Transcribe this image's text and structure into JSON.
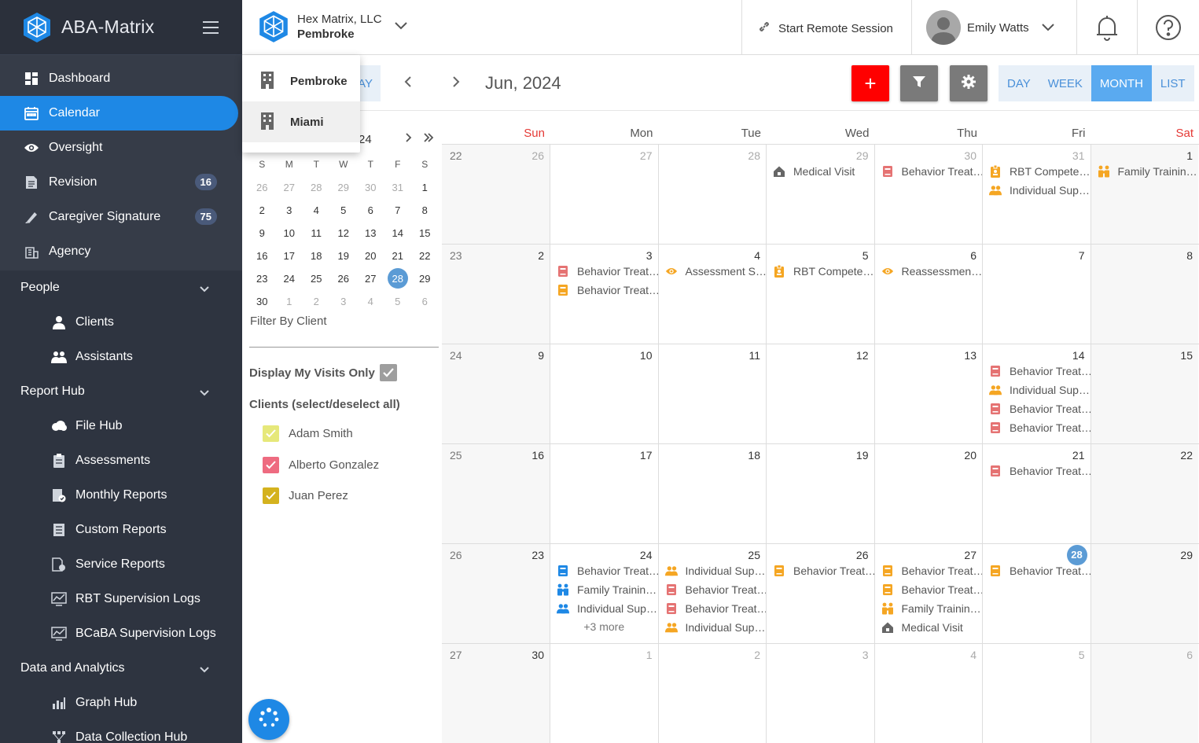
{
  "sidebar": {
    "title": "ABA-Matrix",
    "items": [
      {
        "label": "Dashboard",
        "icon": "dashboard-icon"
      },
      {
        "label": "Calendar",
        "icon": "calendar-icon",
        "active": true
      },
      {
        "label": "Oversight",
        "icon": "eye-icon"
      },
      {
        "label": "Revision",
        "icon": "document-icon",
        "badge": "16"
      },
      {
        "label": "Caregiver Signature",
        "icon": "signature-icon",
        "badge": "75"
      },
      {
        "label": "Agency",
        "icon": "building-icon"
      }
    ],
    "sections": [
      {
        "label": "People",
        "items": [
          {
            "label": "Clients",
            "icon": "person-icon"
          },
          {
            "label": "Assistants",
            "icon": "people-icon"
          }
        ]
      },
      {
        "label": "Report Hub",
        "items": [
          {
            "label": "File Hub",
            "icon": "cloud-icon"
          },
          {
            "label": "Assessments",
            "icon": "clipboard-icon"
          },
          {
            "label": "Monthly Reports",
            "icon": "report-icon"
          },
          {
            "label": "Custom Reports",
            "icon": "list-doc-icon"
          },
          {
            "label": "Service Reports",
            "icon": "service-doc-icon"
          },
          {
            "label": "RBT Supervision Logs",
            "icon": "chart-log-icon"
          },
          {
            "label": "BCaBA Supervision Logs",
            "icon": "chart-log-icon"
          }
        ]
      },
      {
        "label": "Data and Analytics",
        "items": [
          {
            "label": "Graph Hub",
            "icon": "bar-chart-icon"
          },
          {
            "label": "Data Collection Hub",
            "icon": "network-icon"
          }
        ]
      }
    ]
  },
  "topbar": {
    "org_name": "Hex Matrix, LLC",
    "org_location": "Pembroke",
    "remote_label": "Start Remote Session",
    "user_name": "Emily Watts"
  },
  "dropdown": {
    "items": [
      "Pembroke",
      "Miami"
    ]
  },
  "toolbar": {
    "today_label": "AY",
    "month_label": "Jun, 2024",
    "add_label": "+",
    "views": [
      "DAY",
      "WEEK",
      "MONTH",
      "LIST"
    ],
    "active_view": "MONTH"
  },
  "minical": {
    "year_fragment": "24",
    "dow": [
      "S",
      "M",
      "T",
      "W",
      "T",
      "F",
      "S"
    ],
    "rows": [
      [
        "26",
        "27",
        "28",
        "29",
        "30",
        "31",
        "1"
      ],
      [
        "2",
        "3",
        "4",
        "5",
        "6",
        "7",
        "8"
      ],
      [
        "9",
        "10",
        "11",
        "12",
        "13",
        "14",
        "15"
      ],
      [
        "16",
        "17",
        "18",
        "19",
        "20",
        "21",
        "22"
      ],
      [
        "23",
        "24",
        "25",
        "26",
        "27",
        "28",
        "29"
      ],
      [
        "30",
        "1",
        "2",
        "3",
        "4",
        "5",
        "6"
      ]
    ],
    "selected": "28"
  },
  "filters": {
    "filter_by_client": "Filter By Client",
    "display_my_visits": "Display My Visits Only",
    "clients_label": "Clients (select/deselect all)",
    "clients": [
      {
        "name": "Adam Smith",
        "color": "#e6e87a"
      },
      {
        "name": "Alberto Gonzalez",
        "color": "#ee6b80"
      },
      {
        "name": "Juan Perez",
        "color": "#d4b21e"
      }
    ]
  },
  "calendar": {
    "dow": [
      "Sun",
      "Mon",
      "Tue",
      "Wed",
      "Thu",
      "Fri",
      "Sat"
    ],
    "weeks": [
      {
        "num": "22",
        "days": [
          {
            "d": "26",
            "dim": true,
            "events": []
          },
          {
            "d": "27",
            "dim": true,
            "events": []
          },
          {
            "d": "28",
            "dim": true,
            "events": []
          },
          {
            "d": "29",
            "dim": true,
            "events": [
              {
                "t": "Medical Visit",
                "i": "house",
                "c": "#666"
              }
            ]
          },
          {
            "d": "30",
            "dim": true,
            "events": [
              {
                "t": "Behavior Treat…",
                "i": "book",
                "c": "#e57373"
              }
            ]
          },
          {
            "d": "31",
            "dim": true,
            "events": [
              {
                "t": "RBT Compete…",
                "i": "badge",
                "c": "#f5a623"
              },
              {
                "t": "Individual Sup…",
                "i": "people",
                "c": "#f5a623"
              }
            ]
          },
          {
            "d": "1",
            "events": [
              {
                "t": "Family Trainin…",
                "i": "family",
                "c": "#f5a623"
              }
            ]
          }
        ]
      },
      {
        "num": "23",
        "days": [
          {
            "d": "2",
            "events": []
          },
          {
            "d": "3",
            "events": [
              {
                "t": "Behavior Treat…",
                "i": "book",
                "c": "#e57373"
              },
              {
                "t": "Behavior Treat…",
                "i": "book",
                "c": "#f5a623"
              }
            ]
          },
          {
            "d": "4",
            "events": [
              {
                "t": "Assessment S…",
                "i": "eye",
                "c": "#f5a623"
              }
            ]
          },
          {
            "d": "5",
            "events": [
              {
                "t": "RBT Compete…",
                "i": "badge",
                "c": "#f5a623"
              }
            ]
          },
          {
            "d": "6",
            "events": [
              {
                "t": "Reassessmen…",
                "i": "eye",
                "c": "#f5a623"
              }
            ]
          },
          {
            "d": "7",
            "events": []
          },
          {
            "d": "8",
            "events": []
          }
        ]
      },
      {
        "num": "24",
        "days": [
          {
            "d": "9",
            "events": []
          },
          {
            "d": "10",
            "events": []
          },
          {
            "d": "11",
            "events": []
          },
          {
            "d": "12",
            "events": []
          },
          {
            "d": "13",
            "events": []
          },
          {
            "d": "14",
            "events": [
              {
                "t": "Behavior Treat…",
                "i": "book",
                "c": "#e57373"
              },
              {
                "t": "Individual Sup…",
                "i": "people",
                "c": "#f5a623"
              },
              {
                "t": "Behavior Treat…",
                "i": "book",
                "c": "#e57373"
              },
              {
                "t": "Behavior Treat…",
                "i": "book",
                "c": "#e57373"
              }
            ]
          },
          {
            "d": "15",
            "events": []
          }
        ]
      },
      {
        "num": "25",
        "days": [
          {
            "d": "16",
            "events": []
          },
          {
            "d": "17",
            "events": []
          },
          {
            "d": "18",
            "events": []
          },
          {
            "d": "19",
            "events": []
          },
          {
            "d": "20",
            "events": []
          },
          {
            "d": "21",
            "events": [
              {
                "t": "Behavior Treat…",
                "i": "book",
                "c": "#e57373"
              }
            ]
          },
          {
            "d": "22",
            "events": []
          }
        ]
      },
      {
        "num": "26",
        "days": [
          {
            "d": "23",
            "events": []
          },
          {
            "d": "24",
            "events": [
              {
                "t": "Behavior Treat…",
                "i": "book",
                "c": "#1e88e5"
              },
              {
                "t": "Family Trainin…",
                "i": "family",
                "c": "#1e88e5"
              },
              {
                "t": "Individual Sup…",
                "i": "people",
                "c": "#1e88e5"
              }
            ],
            "more": "+3 more"
          },
          {
            "d": "25",
            "events": [
              {
                "t": "Individual Sup…",
                "i": "people",
                "c": "#f5a623"
              },
              {
                "t": "Behavior Treat…",
                "i": "book",
                "c": "#e57373"
              },
              {
                "t": "Behavior Treat…",
                "i": "book",
                "c": "#e57373"
              },
              {
                "t": "Individual Sup…",
                "i": "people",
                "c": "#f5a623"
              }
            ]
          },
          {
            "d": "26",
            "events": [
              {
                "t": "Behavior Treat…",
                "i": "book",
                "c": "#f5a623"
              }
            ]
          },
          {
            "d": "27",
            "events": [
              {
                "t": "Behavior Treat…",
                "i": "book",
                "c": "#f5a623"
              },
              {
                "t": "Behavior Treat…",
                "i": "book",
                "c": "#f5a623"
              },
              {
                "t": "Family Trainin…",
                "i": "family",
                "c": "#f5a623"
              },
              {
                "t": "Medical Visit",
                "i": "house",
                "c": "#666"
              }
            ]
          },
          {
            "d": "28",
            "today": true,
            "events": [
              {
                "t": "Behavior Treat…",
                "i": "book",
                "c": "#f5a623"
              }
            ]
          },
          {
            "d": "29",
            "events": []
          }
        ]
      },
      {
        "num": "27",
        "days": [
          {
            "d": "30",
            "events": []
          },
          {
            "d": "1",
            "dim": true,
            "events": []
          },
          {
            "d": "2",
            "dim": true,
            "events": []
          },
          {
            "d": "3",
            "dim": true,
            "events": []
          },
          {
            "d": "4",
            "dim": true,
            "events": []
          },
          {
            "d": "5",
            "dim": true,
            "events": []
          },
          {
            "d": "6",
            "dim": true,
            "events": []
          }
        ]
      }
    ]
  }
}
